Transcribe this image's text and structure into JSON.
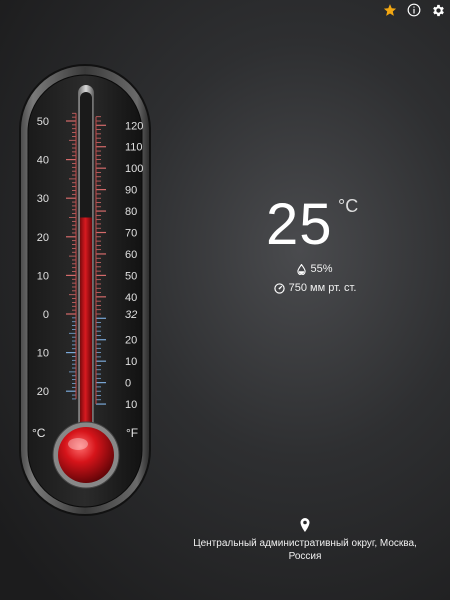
{
  "toolbar": {
    "icons": [
      "star-icon",
      "info-icon",
      "gear-icon"
    ],
    "star_color": "#f2a712"
  },
  "thermometer": {
    "celsius_unit": "°C",
    "fahrenheit_unit": "°F",
    "celsius_ticks": [
      "50",
      "40",
      "30",
      "20",
      "10",
      "0",
      "10",
      "20"
    ],
    "fahrenheit_ticks": [
      "120",
      "110",
      "100",
      "90",
      "80",
      "70",
      "60",
      "50",
      "40",
      "32",
      "20",
      "10",
      "0",
      "10"
    ],
    "celsius_range": [
      -20,
      50
    ],
    "current_celsius": 25,
    "mercury_color": "#c8141a"
  },
  "reading": {
    "temperature": "25",
    "unit": "°C",
    "humidity": "55%",
    "pressure": "750 мм рт. ст."
  },
  "location": {
    "icon": "location-pin-icon",
    "text": "Центральный административный округ, Москва, Россия"
  }
}
